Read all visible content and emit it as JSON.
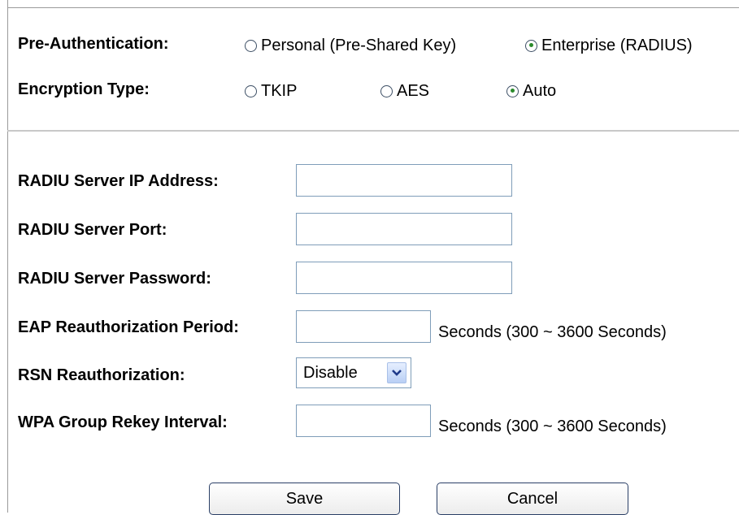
{
  "pre_authentication": {
    "label": "Pre-Authentication:",
    "options": [
      {
        "label": "Personal (Pre-Shared Key)",
        "checked": false
      },
      {
        "label": "Enterprise (RADIUS)",
        "checked": true
      }
    ]
  },
  "encryption_type": {
    "label": "Encryption Type:",
    "options": [
      {
        "label": "TKIP",
        "checked": false
      },
      {
        "label": "AES",
        "checked": false
      },
      {
        "label": "Auto",
        "checked": true
      }
    ]
  },
  "radius_ip": {
    "label": "RADIU Server IP Address:",
    "value": ""
  },
  "radius_port": {
    "label": "RADIU Server Port:",
    "value": ""
  },
  "radius_password": {
    "label": "RADIU Server Password:",
    "value": ""
  },
  "eap_period": {
    "label": "EAP Reauthorization Period:",
    "value": "",
    "hint": "Seconds  (300 ~ 3600 Seconds)"
  },
  "rsn_reauth": {
    "label": "RSN Reauthorization:",
    "selected": "Disable"
  },
  "wpa_rekey": {
    "label": "WPA Group Rekey Interval:",
    "value": "",
    "hint": "Seconds  (300 ~ 3600 Seconds)"
  },
  "buttons": {
    "save": "Save",
    "cancel": "Cancel"
  },
  "colors": {
    "radio_dot": "#2a8a2a",
    "input_border": "#7f9db9",
    "button_border": "#2a3f66"
  }
}
